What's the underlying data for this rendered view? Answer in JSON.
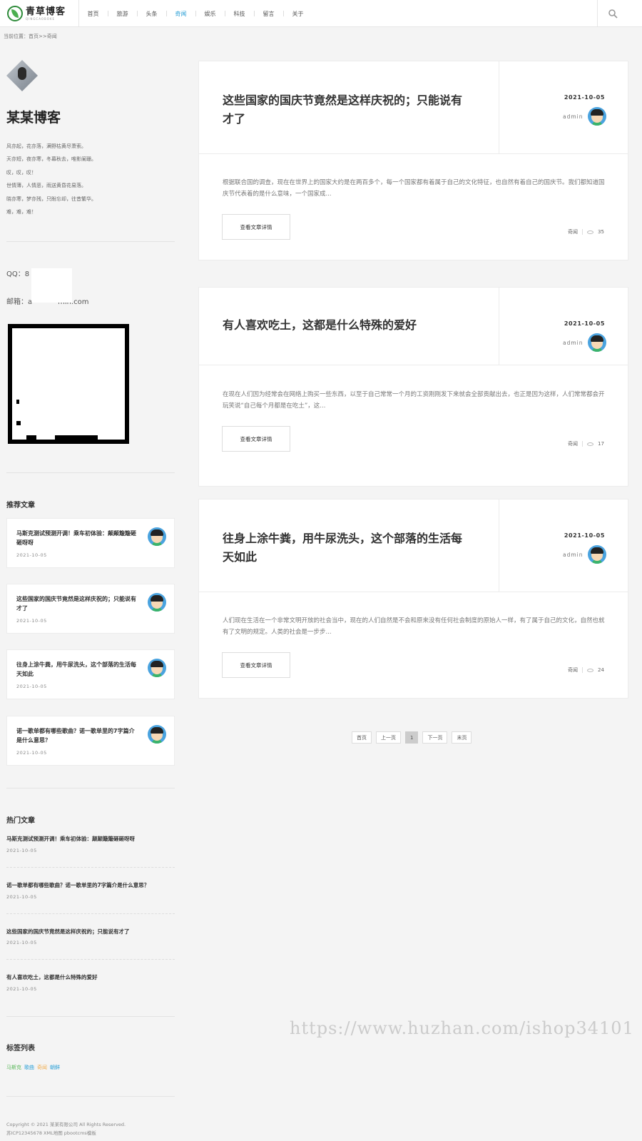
{
  "header": {
    "logo_title": "青草博客",
    "logo_sub": "QINGCAOBOKE",
    "nav": [
      "首页",
      "旅游",
      "头条",
      "奇闻",
      "娱乐",
      "科技",
      "留言",
      "关于"
    ],
    "active_nav": "奇闻"
  },
  "breadcrumb": "当前位置：首页>>奇闻",
  "sidebar": {
    "blog_name": "某某博客",
    "motto": [
      "风亦起，花亦落，满野枯黄尽萧索。",
      "天亦短，夜亦寒，冬幕秋去，唯影阑珊。",
      "叹，叹，叹！",
      "世情薄，人情恶，雨送黄昏花易落。",
      "晓亦寒，梦亦残，只盼忘却，往昔繁华。",
      "难，难，难！"
    ],
    "qq": "QQ：8",
    "email": "邮箱：a",
    "email_tail": "min.com",
    "recommend_title": "推荐文章",
    "recommend": [
      {
        "title": "马斯克测试预测开调！乘车初体验：颠颠簸簸砸砸呀呀",
        "date": "2021-10-05"
      },
      {
        "title": "这些国家的国庆节竟然是这样庆祝的；只能说有才了",
        "date": "2021-10-05"
      },
      {
        "title": "往身上涂牛粪，用牛尿洗头，这个部落的生活每天如此",
        "date": "2021-10-05"
      },
      {
        "title": "诺一歌单都有哪些歌曲？诺一歌单里的7字篇介是什么意思？",
        "date": "2021-10-05"
      }
    ],
    "hot_title": "热门文章",
    "hot": [
      {
        "title": "马斯克测试预测开调！乘车初体验：颠颠簸簸砸砸呀呀",
        "date": "2021-10-05"
      },
      {
        "title": "诺一歌单都有哪些歌曲？诺一歌单里的7字篇介是什么意思？",
        "date": "2021-10-05"
      },
      {
        "title": "这些国家的国庆节竟然是这样庆祝的；只能说有才了",
        "date": "2021-10-05"
      },
      {
        "title": "有人喜欢吃土，这都是什么特殊的爱好",
        "date": "2021-10-05"
      }
    ],
    "tags_title": "标签列表",
    "tags": [
      {
        "label": "马斯克",
        "color": "#5cb85c"
      },
      {
        "label": "歌曲",
        "color": "#2a9fd6"
      },
      {
        "label": "奇闻",
        "color": "#f0ad4e"
      },
      {
        "label": "朝鲜",
        "color": "#2a9fd6"
      }
    ]
  },
  "articles": [
    {
      "title": "这些国家的国庆节竟然是这样庆祝的；只能说有才了",
      "date": "2021-10-05",
      "author": "admin",
      "summary": "根据联合国的调查，现在在世界上的国家大约是在两百多个，每一个国家都有着属于自己的文化特征，也自然有着自己的国庆节。我们都知道国庆节代表着的是什么意味，一个国家成...",
      "button": "查看文章详情",
      "category": "奇闻",
      "views": "35"
    },
    {
      "title": "有人喜欢吃土，这都是什么特殊的爱好",
      "date": "2021-10-05",
      "author": "admin",
      "summary": "在现在人们因为经常会在网络上购买一些东西，以至于自己常常一个月的工资刚刚发下来就会全部贡献出去，也正是因为这样，人们常常都会开玩笑说“自己每个月都是在吃土”，这...",
      "button": "查看文章详情",
      "category": "奇闻",
      "views": "17"
    },
    {
      "title": "往身上涂牛粪，用牛尿洗头，这个部落的生活每天如此",
      "date": "2021-10-05",
      "author": "admin",
      "summary": "人们现在生活在一个非常文明开放的社会当中，现在的人们自然是不会和原来没有任何社会制度的原始人一样，有了属于自己的文化，自然也就有了文明的规定。人类的社会是一步步...",
      "button": "查看文章详情",
      "category": "奇闻",
      "views": "24"
    }
  ],
  "pager": {
    "first": "首页",
    "prev": "上一页",
    "current": "1",
    "next": "下一页",
    "last": "末页"
  },
  "footer": {
    "copyright": "Copyright © 2021 某某有限公司 All Rights Reserved.",
    "icp": "苏ICP12345678 XML地图 pbootcms模板"
  },
  "watermark": "https://www.huzhan.com/ishop34101"
}
